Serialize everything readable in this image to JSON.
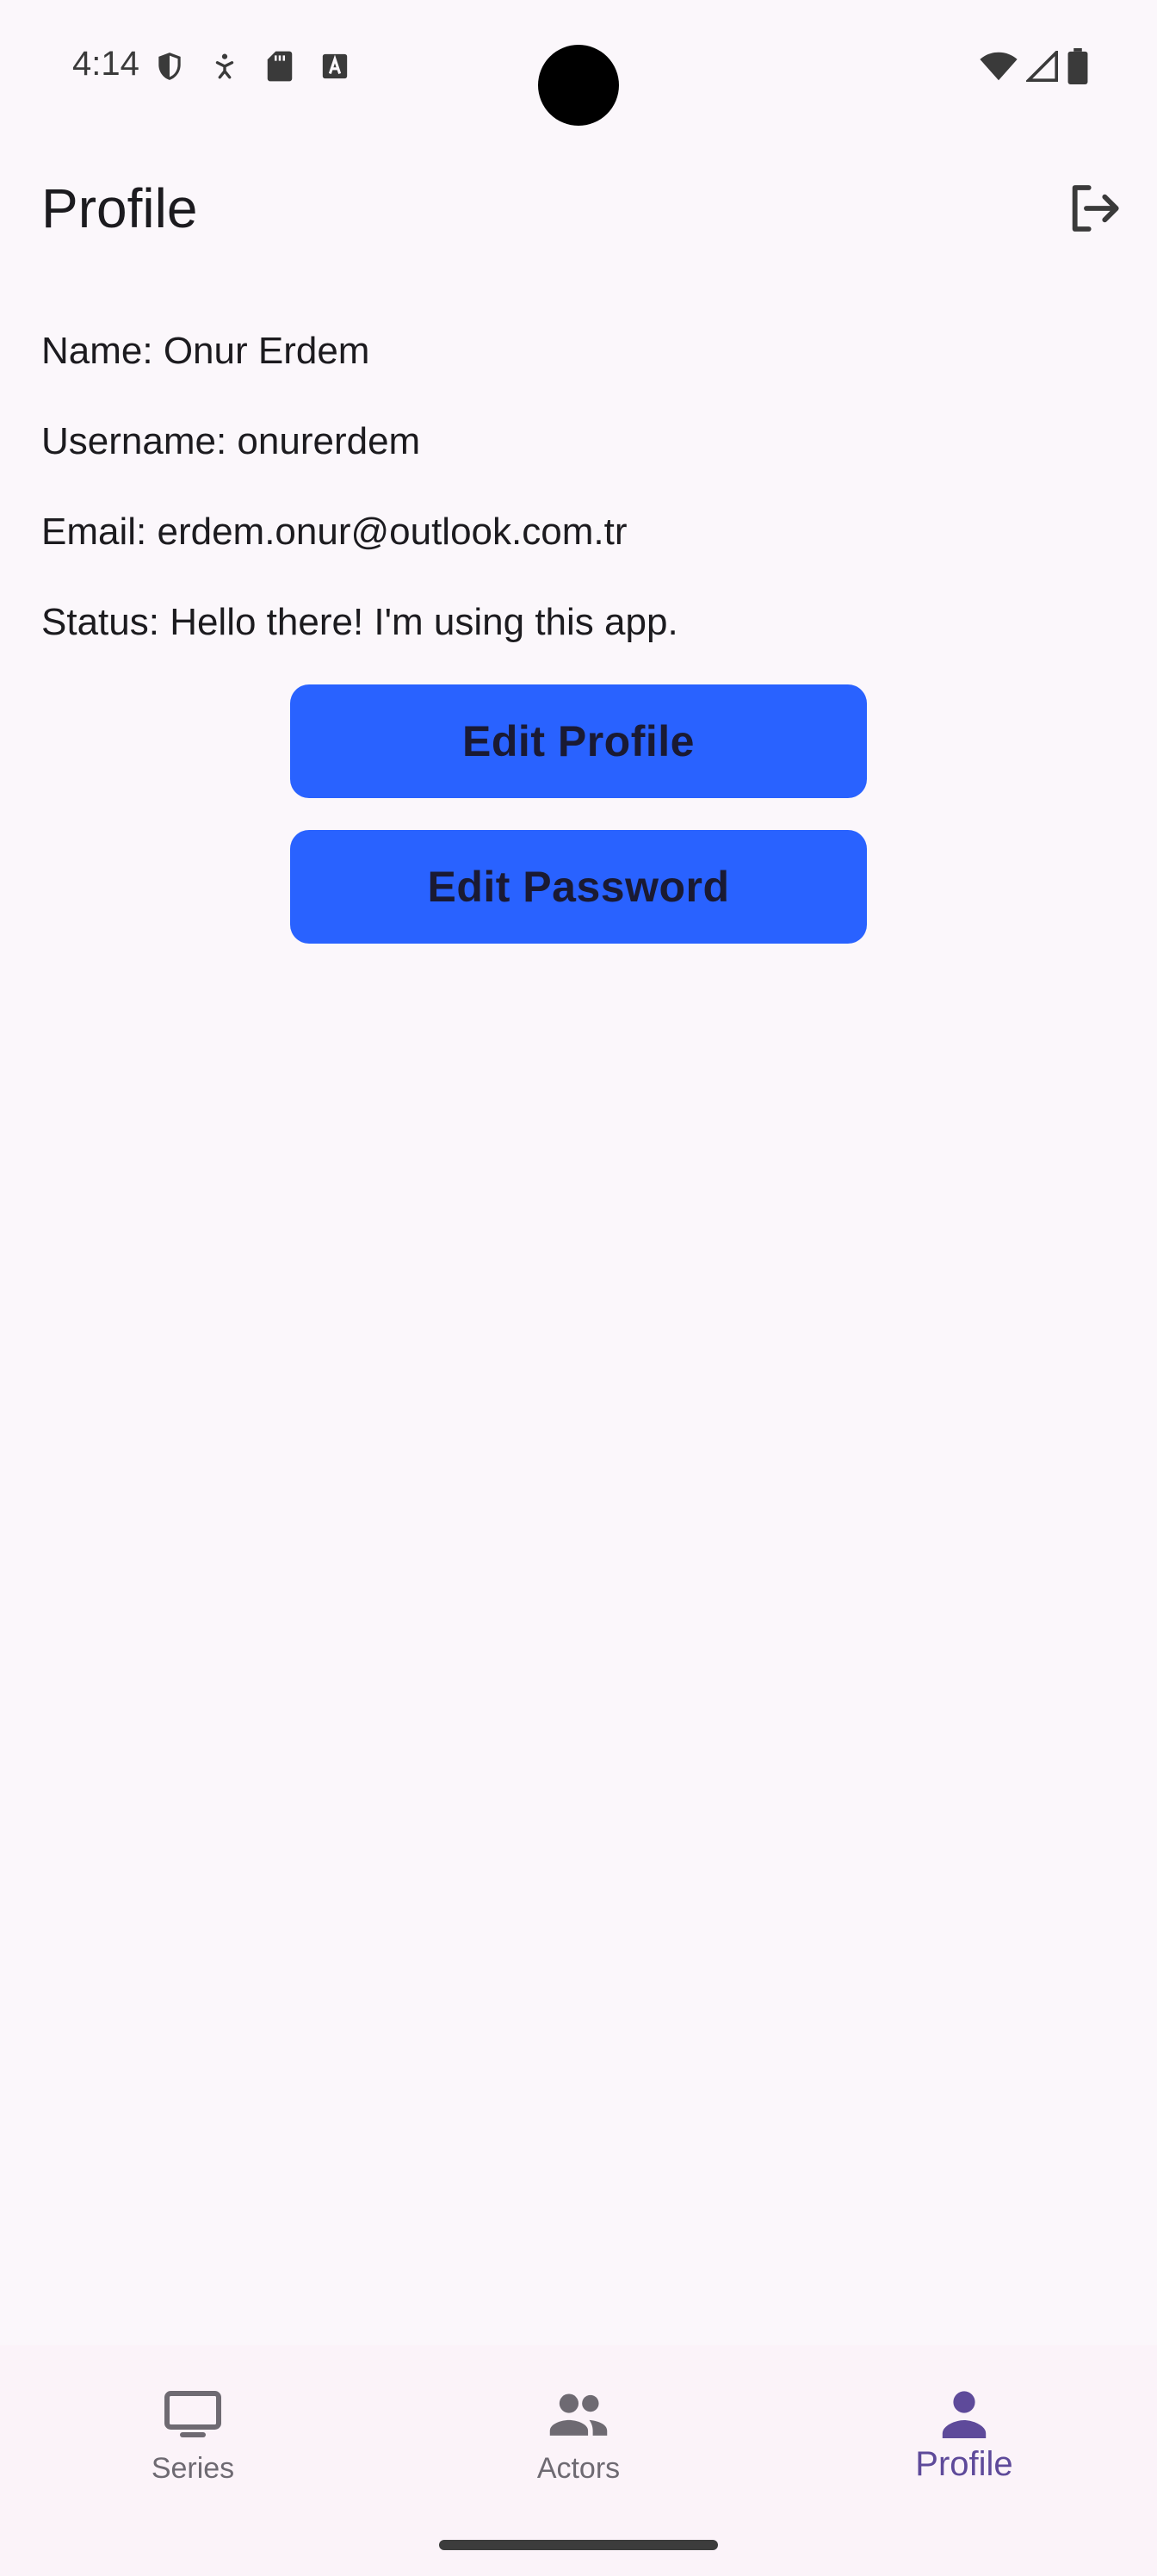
{
  "status_bar": {
    "time": "4:14",
    "left_icons": [
      "shield-icon",
      "accessibility-icon",
      "sd-card-icon",
      "keyboard-a-icon"
    ],
    "right_icons": [
      "wifi-icon",
      "signal-icon",
      "battery-icon"
    ]
  },
  "app_bar": {
    "title": "Profile",
    "action_icon": "logout-icon"
  },
  "profile": {
    "name_line": "Name: Onur Erdem",
    "username_line": "Username: onurerdem",
    "email_line": "Email: erdem.onur@outlook.com.tr",
    "status_line": "Status: Hello there! I'm using this app."
  },
  "buttons": {
    "edit_profile": "Edit Profile",
    "edit_password": "Edit Password"
  },
  "bottom_nav": {
    "items": [
      {
        "label": "Series",
        "icon": "tv-icon",
        "active": false
      },
      {
        "label": "Actors",
        "icon": "people-icon",
        "active": false
      },
      {
        "label": "Profile",
        "icon": "person-icon",
        "active": true
      }
    ]
  },
  "colors": {
    "background": "#FBF7FB",
    "button": "#2962FF",
    "nav_active": "#5E4A9A",
    "nav_inactive": "#6E6A72"
  }
}
